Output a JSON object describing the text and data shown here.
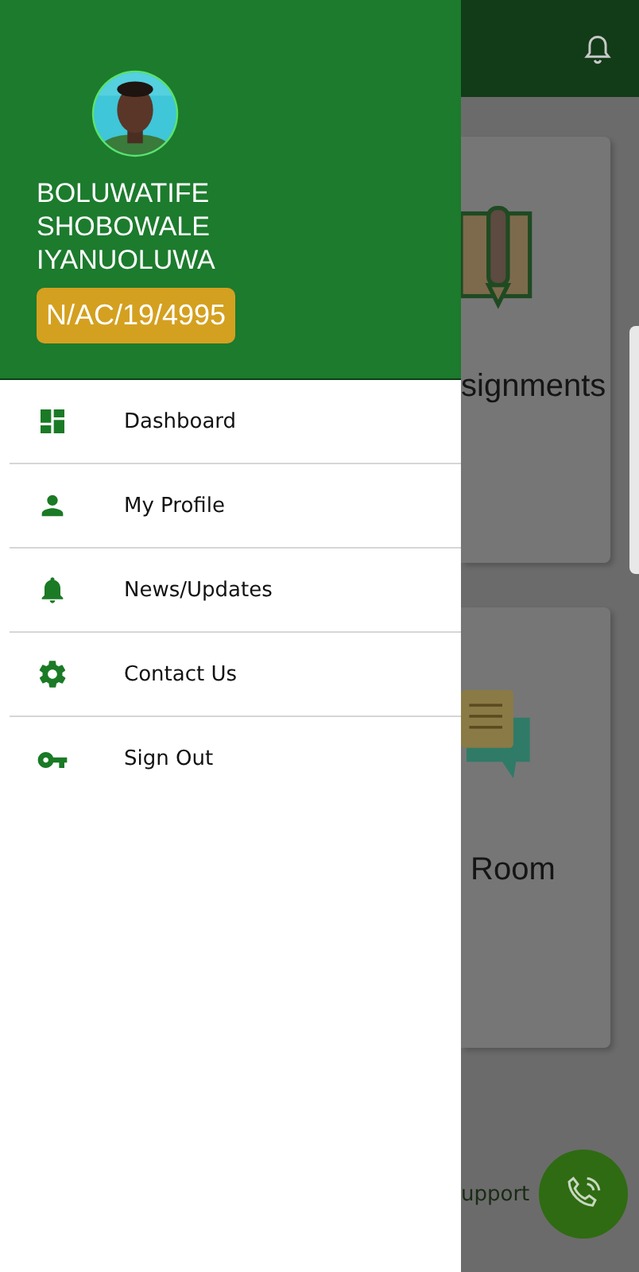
{
  "drawer": {
    "profile": {
      "name": "BOLUWATIFE SHOBOWALE IYANUOLUWA",
      "id_badge": "N/AC/19/4995"
    },
    "menu": [
      {
        "kind": "dashboard",
        "label": "Dashboard"
      },
      {
        "kind": "profile",
        "label": "My Profile"
      },
      {
        "kind": "news",
        "label": "News/Updates"
      },
      {
        "kind": "contact",
        "label": "Contact Us"
      },
      {
        "kind": "signout",
        "label": "Sign Out"
      }
    ]
  },
  "background": {
    "cards": [
      {
        "kind": "assignments",
        "label": "signments"
      },
      {
        "kind": "chat",
        "label": "Room"
      }
    ],
    "support": {
      "label": "upport"
    }
  }
}
